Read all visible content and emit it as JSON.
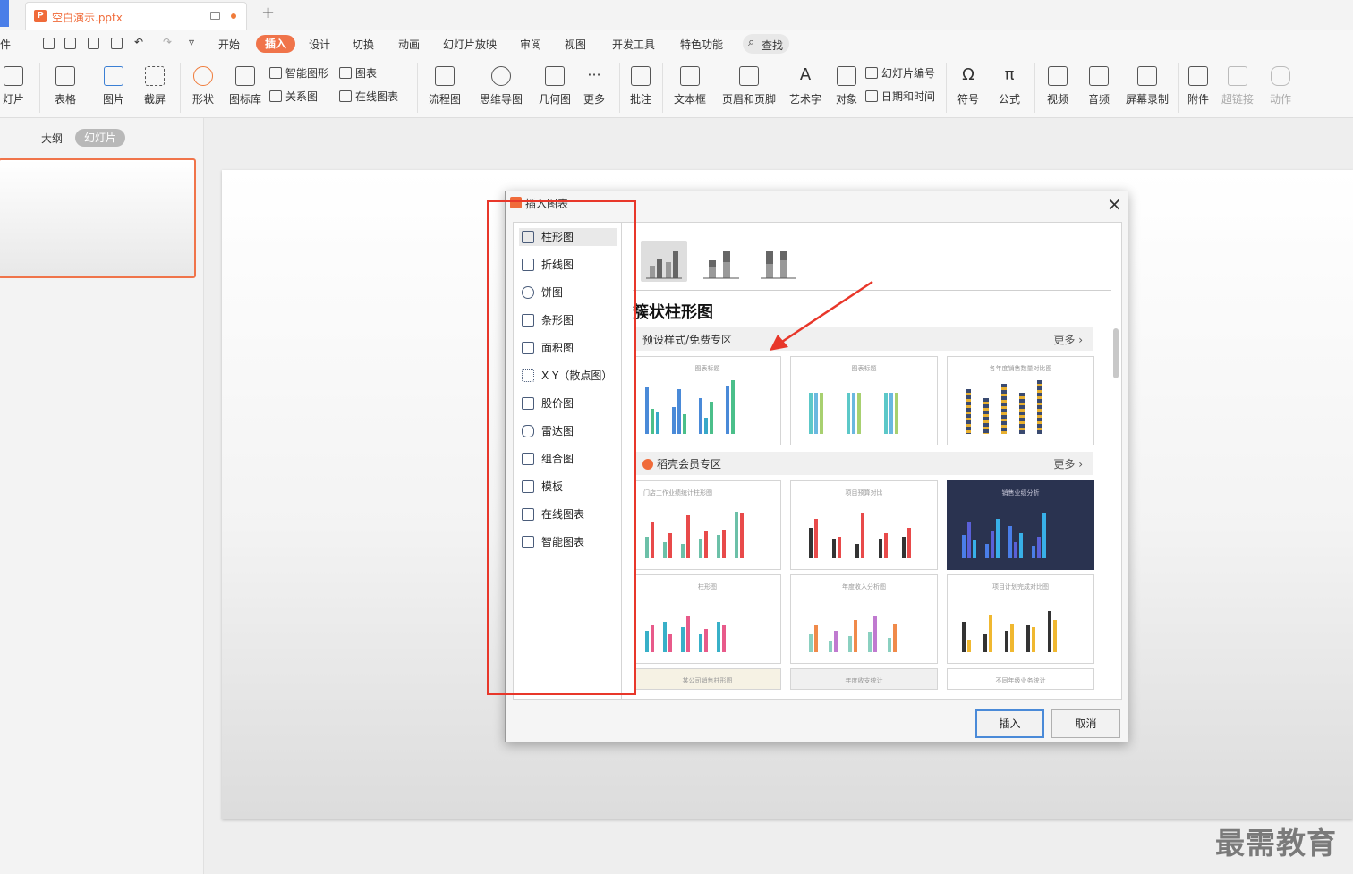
{
  "titlebar": {
    "doc_title": "空白演示.pptx",
    "new_tab": "+"
  },
  "menubar": {
    "left_stub": "件",
    "tabs": [
      "开始",
      "插入",
      "设计",
      "切换",
      "动画",
      "幻灯片放映",
      "审阅",
      "视图",
      "开发工具",
      "特色功能"
    ],
    "search": "查找"
  },
  "ribbon": {
    "slides": "灯片",
    "table": "表格",
    "picture": "图片",
    "screenshot": "截屏",
    "shape": "形状",
    "icon_lib": "图标库",
    "smart_shape": "智能图形",
    "chart": "图表",
    "relation": "关系图",
    "online_chart": "在线图表",
    "flowchart": "流程图",
    "mindmap": "思维导图",
    "geometry": "几何图",
    "more": "更多",
    "comment": "批注",
    "textbox": "文本框",
    "header_footer": "页眉和页脚",
    "art_text": "艺术字",
    "object": "对象",
    "slide_number": "幻灯片编号",
    "datetime": "日期和时间",
    "symbol": "符号",
    "formula": "公式",
    "video": "视频",
    "audio": "音频",
    "screen_record": "屏幕录制",
    "attachment": "附件",
    "hyperlink": "超链接",
    "action": "动作"
  },
  "leftpane": {
    "outline": "大纲",
    "slides": "幻灯片"
  },
  "dialog": {
    "title": "插入图表",
    "categories": [
      "柱形图",
      "折线图",
      "饼图",
      "条形图",
      "面积图",
      "X Y（散点图）",
      "股价图",
      "雷达图",
      "组合图",
      "模板",
      "在线图表",
      "智能图表"
    ],
    "selected_category": "柱形图",
    "content_title": "簇状柱形图",
    "section_free": "预设样式/免费专区",
    "section_member": "稻壳会员专区",
    "more": "更多",
    "card_captions": [
      "图表标题",
      "图表标题",
      "各年度销售数量对比图",
      "门店工作业绩统计柱形图",
      "项目预算对比",
      "销售业绩分析",
      "柱形图",
      "年度收入分析图",
      "项目计划完成对比图",
      "某公司销售柱形图",
      "年度收支统计",
      "不同年级业务统计"
    ],
    "insert": "插入",
    "cancel": "取消"
  },
  "watermark": "最需教育",
  "colors": {
    "accent": "#f0744a",
    "highlight_box": "#e8372a",
    "bar_blue": "#4a8ad8",
    "bar_green": "#4bbf8a"
  }
}
